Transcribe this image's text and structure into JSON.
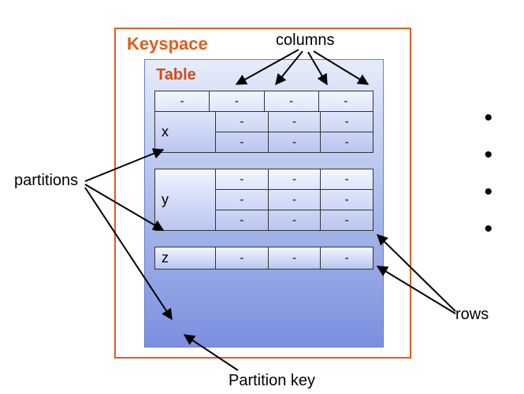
{
  "keyspace_label": "Keyspace",
  "table_label": "Table",
  "annotations": {
    "columns": "columns",
    "partitions": "partitions",
    "rows": "rows",
    "partition_key": "Partition key"
  },
  "cell_placeholder": "-",
  "partitions": [
    {
      "key": "x",
      "rows": 2,
      "cols": 3,
      "header_row": true
    },
    {
      "key": "y",
      "rows": 3,
      "cols": 3,
      "header_row": false
    },
    {
      "key": "z",
      "rows": 1,
      "cols": 3,
      "header_row": false
    }
  ],
  "bullets": [
    "•",
    "•",
    "•",
    "•"
  ]
}
